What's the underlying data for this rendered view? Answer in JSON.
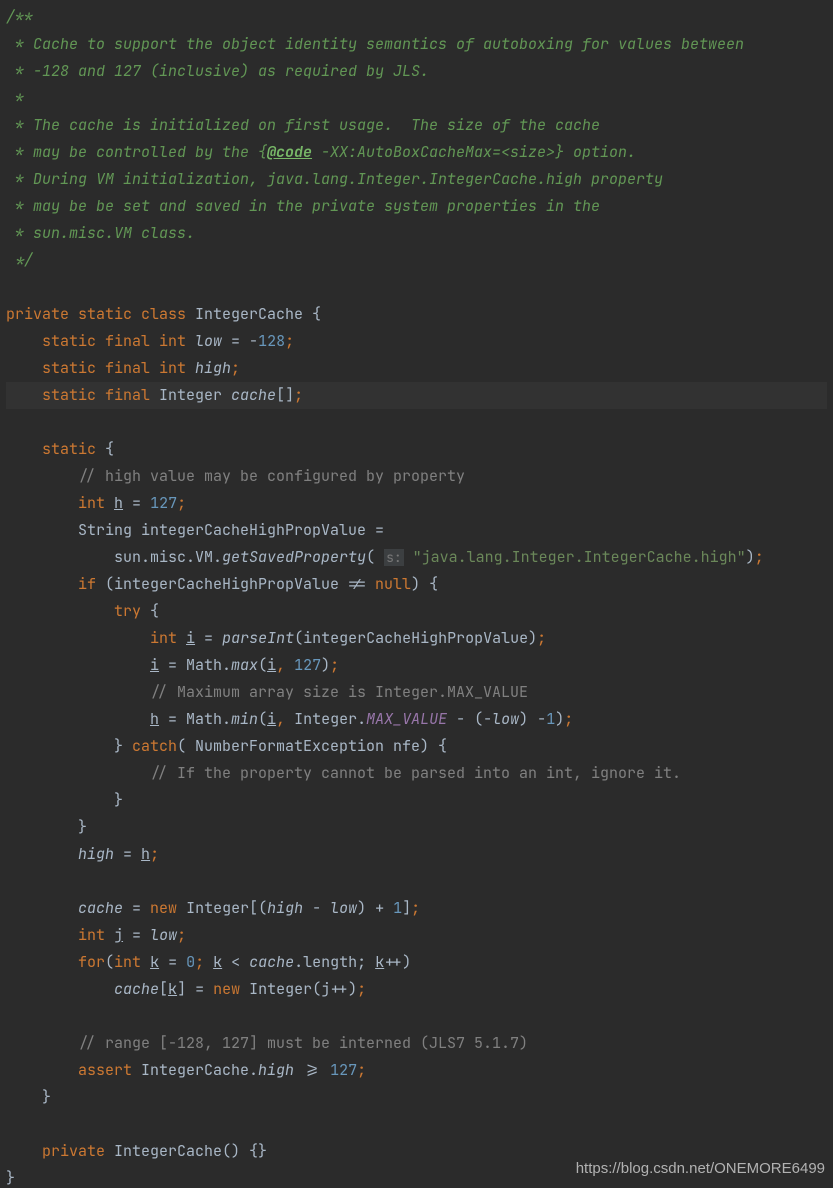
{
  "doc": {
    "lines": [
      {
        "t": "c",
        "text": "/**"
      },
      {
        "t": "c",
        "text": " * Cache to support the object identity semantics of autoboxing for values between"
      },
      {
        "t": "c",
        "text": " * -128 and 127 (inclusive) as required by JLS."
      },
      {
        "t": "c",
        "text": " *"
      },
      {
        "t": "c",
        "text": " * The cache is initialized on first usage.  The size of the cache"
      },
      {
        "t": "code_tag",
        "prefix": " * may be controlled by the {",
        "tag": "@code",
        "suffix": " -XX:AutoBoxCacheMax=<size>} option."
      },
      {
        "t": "c",
        "text": " * During VM initialization, java.lang.Integer.IntegerCache.high property"
      },
      {
        "t": "c",
        "text": " * may be be set and saved in the private system properties in the"
      },
      {
        "t": "c",
        "text": " * sun.misc.VM class."
      },
      {
        "t": "c",
        "text": " */"
      },
      {
        "t": "blank"
      },
      {
        "t": "decl",
        "kw1": "private",
        "kw2": "static",
        "kw3": "class",
        "name": "IntegerCache",
        "brace": " {"
      },
      {
        "t": "field",
        "indent": "    ",
        "mods": "static final int",
        "name": "low",
        "rest": " = -",
        "num": "128",
        "end": ";"
      },
      {
        "t": "field_simple",
        "indent": "    ",
        "mods": "static final int",
        "name": "high",
        "end": ";"
      },
      {
        "t": "field_arr",
        "hl": true,
        "indent": "    ",
        "mods": "static final",
        "type": "Integer",
        "name": "cache",
        "rest": "[]",
        "end": ";"
      },
      {
        "t": "blank"
      },
      {
        "t": "kw_brace",
        "indent": "    ",
        "kw": "static",
        "brace": " {"
      },
      {
        "t": "lc",
        "indent": "        ",
        "text": "// high value may be configured by property"
      },
      {
        "t": "int_assign",
        "indent": "        ",
        "kw": "int",
        "var": "h",
        "eq": " = ",
        "num": "127",
        "end": ";"
      },
      {
        "t": "plain",
        "indent": "        ",
        "text": "String integerCacheHighPropValue ="
      },
      {
        "t": "call_saved",
        "indent": "            ",
        "prefix": "sun.misc.VM.",
        "fn": "getSavedProperty",
        "open": "( ",
        "hint": "s:",
        "q": " \"java.lang.Integer.IntegerCache.high\"",
        "close": ");"
      },
      {
        "t": "if_null",
        "indent": "        ",
        "kw": "if",
        "open": " (integerCacheHighPropValue != ",
        "nul": "null",
        "close": ") {"
      },
      {
        "t": "kw_brace",
        "indent": "            ",
        "kw": "try",
        "brace": " {"
      },
      {
        "t": "parse",
        "indent": "                ",
        "kw": "int",
        "var": "i",
        "eq": " = ",
        "fn": "parseInt",
        "open": "(integerCacheHighPropValue)",
        "end": ";"
      },
      {
        "t": "math",
        "indent": "                ",
        "var": "i",
        "eq": " = Math.",
        "fn": "max",
        "open": "(",
        "a": "i",
        "comma": ", ",
        "num": "127",
        "close": ")",
        "end": ";"
      },
      {
        "t": "lc",
        "indent": "                ",
        "text": "// Maximum array size is Integer.MAX_VALUE"
      },
      {
        "t": "math_minmax",
        "indent": "                ",
        "var": "h",
        "eq": " = Math.",
        "fn": "min",
        "open": "(",
        "a": "i",
        "comma": ", Integer.",
        "const": "MAX_VALUE",
        "mid": " - (-",
        "low": "low",
        "close": ") -",
        "num": "1",
        "paren": ")",
        "end": ";"
      },
      {
        "t": "catch",
        "indent": "            ",
        "close": "}",
        "kw": "catch",
        "open": "( NumberFormatException nfe) {"
      },
      {
        "t": "lc",
        "indent": "                ",
        "text": "// If the property cannot be parsed into an int, ignore it."
      },
      {
        "t": "close",
        "indent": "            ",
        "text": "}"
      },
      {
        "t": "close",
        "indent": "        ",
        "text": "}"
      },
      {
        "t": "assign_it",
        "indent": "        ",
        "lhs": "high",
        "eq": " = ",
        "rhs": "h",
        "end": ";"
      },
      {
        "t": "blank"
      },
      {
        "t": "cache_new",
        "indent": "        ",
        "lhs": "cache",
        "eq": " = ",
        "kw": "new",
        "type": " Integer[(",
        "h": "high",
        "mid": " - ",
        "l": "low",
        "close": ") + ",
        "num": "1",
        "br": "]",
        "end": ";"
      },
      {
        "t": "int_assign_it",
        "indent": "        ",
        "kw": "int",
        "var": "j",
        "eq": " = ",
        "rhs": "low",
        "end": ";"
      },
      {
        "t": "for",
        "indent": "        ",
        "kw": "for",
        "open": "(",
        "kw2": "int",
        "var": "k",
        "eq": " = ",
        "num": "0",
        "sc": "; ",
        "var2": "k",
        "cmp": " < ",
        "obj": "cache",
        "rest": ".length; ",
        "var3": "k",
        "inc": "++)"
      },
      {
        "t": "cache_assign",
        "indent": "            ",
        "obj": "cache",
        "open": "[",
        "idx": "k",
        "close": "] = ",
        "kw": "new",
        "type": " Integer(j++)",
        "end": ";"
      },
      {
        "t": "blank"
      },
      {
        "t": "lc",
        "indent": "        ",
        "text": "// range [-128, 127] must be interned (JLS7 5.1.7)"
      },
      {
        "t": "assert",
        "indent": "        ",
        "kw": "assert",
        "mid": " IntegerCache.",
        "fld": "high",
        "cmp": " >= ",
        "num": "127",
        "end": ";"
      },
      {
        "t": "close",
        "indent": "    ",
        "text": "}"
      },
      {
        "t": "blank"
      },
      {
        "t": "ctor",
        "indent": "    ",
        "kw": "private",
        "name": "IntegerCache",
        "rest": "() {}"
      },
      {
        "t": "close",
        "indent": "",
        "text": "}"
      }
    ],
    "watermark": "https://blog.csdn.net/ONEMORE6499"
  }
}
